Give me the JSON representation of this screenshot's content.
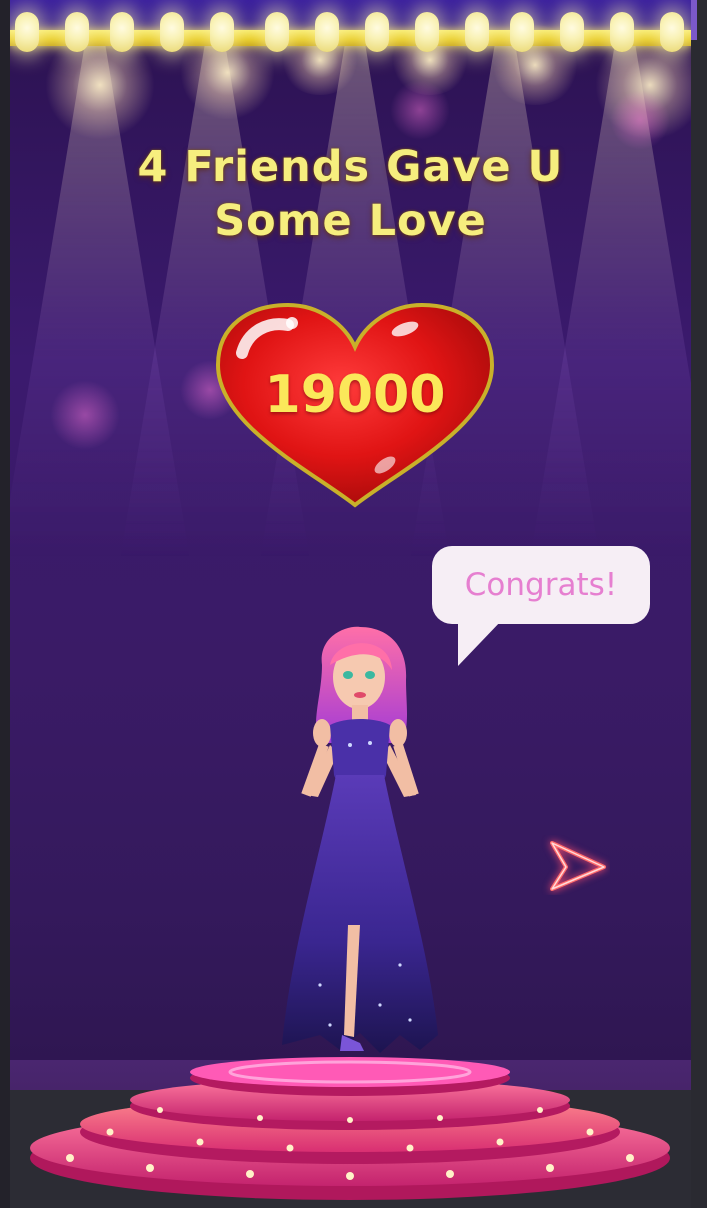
{
  "title": {
    "line1": "4 Friends Gave U",
    "line2": "Some Love"
  },
  "reward": {
    "value": "19000",
    "icon": "heart-icon"
  },
  "speech_bubble": {
    "text": "Congrats!"
  },
  "controls": {
    "next_icon": "arrow-right-icon"
  },
  "colors": {
    "title": "#f6ee7e",
    "heart": "#e01b1b",
    "heart_value": "#fbe85a",
    "bubble_text": "#e67fd0",
    "stage_pink": "#e53a8e",
    "background_purple": "#3a1b66"
  }
}
